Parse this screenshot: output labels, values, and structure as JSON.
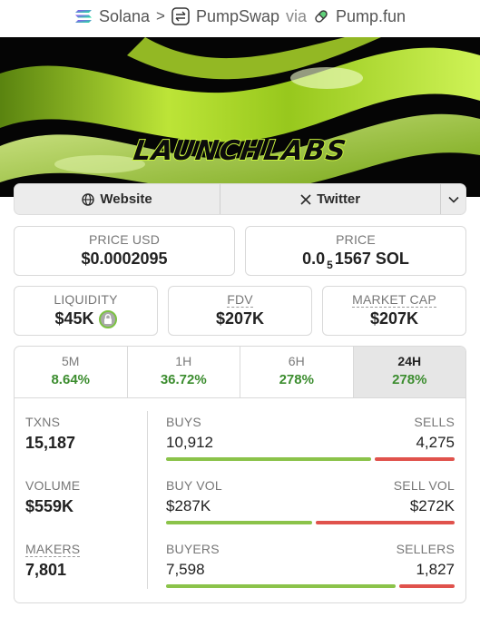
{
  "breadcrumb": {
    "chain": "Solana",
    "separator": ">",
    "dex": "PumpSwap",
    "via": "via",
    "launchpad": "Pump.fun"
  },
  "banner": {
    "brand": "LAUNCHLABS"
  },
  "links": {
    "website": "Website",
    "twitter": "Twitter"
  },
  "price_usd": {
    "label": "PRICE USD",
    "value": "$0.0002095"
  },
  "price": {
    "label": "PRICE",
    "prefix": "0.0",
    "zeros": "5",
    "digits": "1567",
    "unit": "SOL"
  },
  "liquidity": {
    "label": "LIQUIDITY",
    "value": "$45K"
  },
  "fdv": {
    "label": "FDV",
    "value": "$207K"
  },
  "market_cap": {
    "label": "MARKET CAP",
    "value": "$207K"
  },
  "timeframes": [
    {
      "label": "5M",
      "change": "8.64%"
    },
    {
      "label": "1H",
      "change": "36.72%"
    },
    {
      "label": "6H",
      "change": "278%"
    },
    {
      "label": "24H",
      "change": "278%"
    }
  ],
  "txns": {
    "label": "TXNS",
    "value": "15,187",
    "buys_label": "BUYS",
    "buys": "10,912",
    "sells_label": "SELLS",
    "sells": "4,275",
    "buy_share": 0.7185
  },
  "volume": {
    "label": "VOLUME",
    "value": "$559K",
    "buy_label": "BUY VOL",
    "buy": "$287K",
    "sell_label": "SELL VOL",
    "sell": "$272K",
    "buy_share": 0.5134
  },
  "makers": {
    "label": "MAKERS",
    "value": "7,801",
    "buyers_label": "BUYERS",
    "buyers": "7,598",
    "sellers_label": "SELLERS",
    "sellers": "1,827",
    "buy_share": 0.8061
  },
  "colors": {
    "positive": "#3c8d2f",
    "bar_buy": "#8bc34a",
    "bar_sell": "#e0524c",
    "brand_lime": "#c8f23c"
  }
}
